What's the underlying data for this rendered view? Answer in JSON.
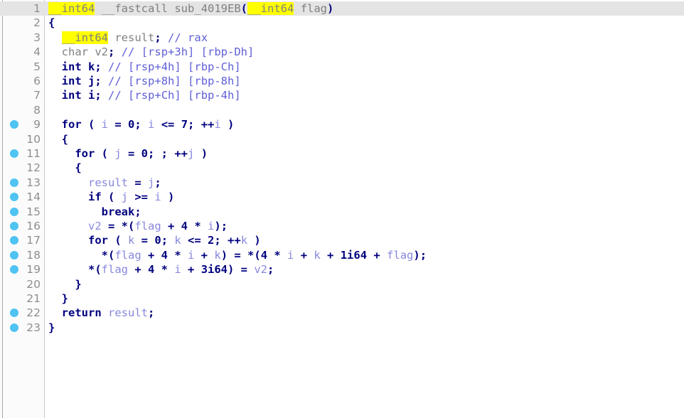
{
  "window": {
    "view": "pseudocode",
    "function_name": "sub_4019EB",
    "highlighted_token": "__int64",
    "current_line": 1
  },
  "colors": {
    "highlight_yellow": "#ffff00",
    "current_line_gray": "#e4e4e4",
    "breakpoint_blue": "#4fc3f2",
    "keyword": "#00007f",
    "comment": "#5f5fd7",
    "variable": "#8888dd",
    "type_gray": "#808080",
    "lineno_gray": "#8e8e8e",
    "background": "#ffffff",
    "gutter_background": "#fbfbfb"
  },
  "lines": [
    {
      "number": "1",
      "breakpoint": false,
      "current": true,
      "text": "__int64 __fastcall sub_4019EB(__int64 flag)",
      "tokens": [
        {
          "t": "__int64",
          "c": "t-type hl"
        },
        {
          "t": " ",
          "c": "t-type"
        },
        {
          "t": "__fastcall",
          "c": "t-type"
        },
        {
          "t": " ",
          "c": "t-type"
        },
        {
          "t": "sub_4019EB",
          "c": "t-fn"
        },
        {
          "t": "(",
          "c": "t-punc"
        },
        {
          "t": "__int64",
          "c": "t-type hl"
        },
        {
          "t": " ",
          "c": "t-type"
        },
        {
          "t": "flag",
          "c": "t-type"
        },
        {
          "t": ")",
          "c": "t-punc"
        }
      ]
    },
    {
      "number": "2",
      "breakpoint": false,
      "current": false,
      "text": "{",
      "tokens": [
        {
          "t": "{",
          "c": "t-punc"
        }
      ]
    },
    {
      "number": "3",
      "breakpoint": false,
      "current": false,
      "text": "  __int64 result; // rax",
      "tokens": [
        {
          "t": "  ",
          "c": "t-type"
        },
        {
          "t": "__int64",
          "c": "t-type hl"
        },
        {
          "t": " ",
          "c": "t-type"
        },
        {
          "t": "result",
          "c": "t-dvar"
        },
        {
          "t": ";",
          "c": "t-punc"
        },
        {
          "t": " ",
          "c": "t-type"
        },
        {
          "t": "// rax",
          "c": "t-cmt"
        }
      ]
    },
    {
      "number": "4",
      "breakpoint": false,
      "current": false,
      "text": "  char v2; // [rsp+3h] [rbp-Dh]",
      "tokens": [
        {
          "t": "  ",
          "c": "t-type"
        },
        {
          "t": "char",
          "c": "t-type"
        },
        {
          "t": " ",
          "c": "t-type"
        },
        {
          "t": "v2",
          "c": "t-dvar"
        },
        {
          "t": ";",
          "c": "t-punc"
        },
        {
          "t": " ",
          "c": "t-type"
        },
        {
          "t": "// [rsp+3h] [rbp-Dh]",
          "c": "t-cmt"
        }
      ]
    },
    {
      "number": "5",
      "breakpoint": false,
      "current": false,
      "text": "  int k; // [rsp+4h] [rbp-Ch]",
      "tokens": [
        {
          "t": "  ",
          "c": "t-type"
        },
        {
          "t": "int",
          "c": "t-kw"
        },
        {
          "t": " ",
          "c": "t-type"
        },
        {
          "t": "k",
          "c": "t-kw"
        },
        {
          "t": ";",
          "c": "t-punc"
        },
        {
          "t": " ",
          "c": "t-type"
        },
        {
          "t": "// [rsp+4h] [rbp-Ch]",
          "c": "t-cmt"
        }
      ]
    },
    {
      "number": "6",
      "breakpoint": false,
      "current": false,
      "text": "  int j; // [rsp+8h] [rbp-8h]",
      "tokens": [
        {
          "t": "  ",
          "c": "t-type"
        },
        {
          "t": "int",
          "c": "t-kw"
        },
        {
          "t": " ",
          "c": "t-type"
        },
        {
          "t": "j",
          "c": "t-kw"
        },
        {
          "t": ";",
          "c": "t-punc"
        },
        {
          "t": " ",
          "c": "t-type"
        },
        {
          "t": "// [rsp+8h] [rbp-8h]",
          "c": "t-cmt"
        }
      ]
    },
    {
      "number": "7",
      "breakpoint": false,
      "current": false,
      "text": "  int i; // [rsp+Ch] [rbp-4h]",
      "tokens": [
        {
          "t": "  ",
          "c": "t-type"
        },
        {
          "t": "int",
          "c": "t-kw"
        },
        {
          "t": " ",
          "c": "t-type"
        },
        {
          "t": "i",
          "c": "t-kw"
        },
        {
          "t": ";",
          "c": "t-punc"
        },
        {
          "t": " ",
          "c": "t-type"
        },
        {
          "t": "// [rsp+Ch] [rbp-4h]",
          "c": "t-cmt"
        }
      ]
    },
    {
      "number": "8",
      "breakpoint": false,
      "current": false,
      "text": "",
      "tokens": []
    },
    {
      "number": "9",
      "breakpoint": true,
      "current": false,
      "text": "  for ( i = 0; i <= 7; ++i )",
      "tokens": [
        {
          "t": "  ",
          "c": "t-type"
        },
        {
          "t": "for",
          "c": "t-kw"
        },
        {
          "t": " ( ",
          "c": "t-punc"
        },
        {
          "t": "i",
          "c": "t-var"
        },
        {
          "t": " = ",
          "c": "t-punc"
        },
        {
          "t": "0",
          "c": "t-num"
        },
        {
          "t": "; ",
          "c": "t-punc"
        },
        {
          "t": "i",
          "c": "t-var"
        },
        {
          "t": " <= ",
          "c": "t-punc"
        },
        {
          "t": "7",
          "c": "t-num"
        },
        {
          "t": "; ++",
          "c": "t-punc"
        },
        {
          "t": "i",
          "c": "t-var"
        },
        {
          "t": " )",
          "c": "t-punc"
        }
      ]
    },
    {
      "number": "10",
      "breakpoint": false,
      "current": false,
      "text": "  {",
      "tokens": [
        {
          "t": "  ",
          "c": "t-type"
        },
        {
          "t": "{",
          "c": "t-punc"
        }
      ]
    },
    {
      "number": "11",
      "breakpoint": true,
      "current": false,
      "text": "    for ( j = 0; ; ++j )",
      "tokens": [
        {
          "t": "    ",
          "c": "t-type"
        },
        {
          "t": "for",
          "c": "t-kw"
        },
        {
          "t": " ( ",
          "c": "t-punc"
        },
        {
          "t": "j",
          "c": "t-var"
        },
        {
          "t": " = ",
          "c": "t-punc"
        },
        {
          "t": "0",
          "c": "t-num"
        },
        {
          "t": "; ; ++",
          "c": "t-punc"
        },
        {
          "t": "j",
          "c": "t-var"
        },
        {
          "t": " )",
          "c": "t-punc"
        }
      ]
    },
    {
      "number": "12",
      "breakpoint": false,
      "current": false,
      "text": "    {",
      "tokens": [
        {
          "t": "    ",
          "c": "t-type"
        },
        {
          "t": "{",
          "c": "t-punc"
        }
      ]
    },
    {
      "number": "13",
      "breakpoint": true,
      "current": false,
      "text": "      result = j;",
      "tokens": [
        {
          "t": "      ",
          "c": "t-type"
        },
        {
          "t": "result",
          "c": "t-var"
        },
        {
          "t": " = ",
          "c": "t-punc"
        },
        {
          "t": "j",
          "c": "t-var"
        },
        {
          "t": ";",
          "c": "t-punc"
        }
      ]
    },
    {
      "number": "14",
      "breakpoint": true,
      "current": false,
      "text": "      if ( j >= i )",
      "tokens": [
        {
          "t": "      ",
          "c": "t-type"
        },
        {
          "t": "if",
          "c": "t-kw"
        },
        {
          "t": " ( ",
          "c": "t-punc"
        },
        {
          "t": "j",
          "c": "t-var"
        },
        {
          "t": " >= ",
          "c": "t-punc"
        },
        {
          "t": "i",
          "c": "t-var"
        },
        {
          "t": " )",
          "c": "t-punc"
        }
      ]
    },
    {
      "number": "15",
      "breakpoint": true,
      "current": false,
      "text": "        break;",
      "tokens": [
        {
          "t": "        ",
          "c": "t-type"
        },
        {
          "t": "break",
          "c": "t-kw"
        },
        {
          "t": ";",
          "c": "t-punc"
        }
      ]
    },
    {
      "number": "16",
      "breakpoint": true,
      "current": false,
      "text": "      v2 = *(flag + 4 * i);",
      "tokens": [
        {
          "t": "      ",
          "c": "t-type"
        },
        {
          "t": "v2",
          "c": "t-var"
        },
        {
          "t": " = *(",
          "c": "t-punc"
        },
        {
          "t": "flag",
          "c": "t-var"
        },
        {
          "t": " + ",
          "c": "t-punc"
        },
        {
          "t": "4",
          "c": "t-num"
        },
        {
          "t": " * ",
          "c": "t-punc"
        },
        {
          "t": "i",
          "c": "t-var"
        },
        {
          "t": ");",
          "c": "t-punc"
        }
      ]
    },
    {
      "number": "17",
      "breakpoint": true,
      "current": false,
      "text": "      for ( k = 0; k <= 2; ++k )",
      "tokens": [
        {
          "t": "      ",
          "c": "t-type"
        },
        {
          "t": "for",
          "c": "t-kw"
        },
        {
          "t": " ( ",
          "c": "t-punc"
        },
        {
          "t": "k",
          "c": "t-var"
        },
        {
          "t": " = ",
          "c": "t-punc"
        },
        {
          "t": "0",
          "c": "t-num"
        },
        {
          "t": "; ",
          "c": "t-punc"
        },
        {
          "t": "k",
          "c": "t-var"
        },
        {
          "t": " <= ",
          "c": "t-punc"
        },
        {
          "t": "2",
          "c": "t-num"
        },
        {
          "t": "; ++",
          "c": "t-punc"
        },
        {
          "t": "k",
          "c": "t-var"
        },
        {
          "t": " )",
          "c": "t-punc"
        }
      ]
    },
    {
      "number": "18",
      "breakpoint": true,
      "current": false,
      "text": "        *(flag + 4 * i + k) = *(4 * i + k + 1i64 + flag);",
      "tokens": [
        {
          "t": "        ",
          "c": "t-type"
        },
        {
          "t": "*(",
          "c": "t-punc"
        },
        {
          "t": "flag",
          "c": "t-var"
        },
        {
          "t": " + ",
          "c": "t-punc"
        },
        {
          "t": "4",
          "c": "t-num"
        },
        {
          "t": " * ",
          "c": "t-punc"
        },
        {
          "t": "i",
          "c": "t-var"
        },
        {
          "t": " + ",
          "c": "t-punc"
        },
        {
          "t": "k",
          "c": "t-var"
        },
        {
          "t": ") = *(",
          "c": "t-punc"
        },
        {
          "t": "4",
          "c": "t-num"
        },
        {
          "t": " * ",
          "c": "t-punc"
        },
        {
          "t": "i",
          "c": "t-var"
        },
        {
          "t": " + ",
          "c": "t-punc"
        },
        {
          "t": "k",
          "c": "t-var"
        },
        {
          "t": " + ",
          "c": "t-punc"
        },
        {
          "t": "1i64",
          "c": "t-num"
        },
        {
          "t": " + ",
          "c": "t-punc"
        },
        {
          "t": "flag",
          "c": "t-var"
        },
        {
          "t": ");",
          "c": "t-punc"
        }
      ]
    },
    {
      "number": "19",
      "breakpoint": true,
      "current": false,
      "text": "      *(flag + 4 * i + 3i64) = v2;",
      "tokens": [
        {
          "t": "      ",
          "c": "t-type"
        },
        {
          "t": "*(",
          "c": "t-punc"
        },
        {
          "t": "flag",
          "c": "t-var"
        },
        {
          "t": " + ",
          "c": "t-punc"
        },
        {
          "t": "4",
          "c": "t-num"
        },
        {
          "t": " * ",
          "c": "t-punc"
        },
        {
          "t": "i",
          "c": "t-var"
        },
        {
          "t": " + ",
          "c": "t-punc"
        },
        {
          "t": "3i64",
          "c": "t-num"
        },
        {
          "t": ") = ",
          "c": "t-punc"
        },
        {
          "t": "v2",
          "c": "t-var"
        },
        {
          "t": ";",
          "c": "t-punc"
        }
      ]
    },
    {
      "number": "20",
      "breakpoint": false,
      "current": false,
      "text": "    }",
      "tokens": [
        {
          "t": "    ",
          "c": "t-type"
        },
        {
          "t": "}",
          "c": "t-punc"
        }
      ]
    },
    {
      "number": "21",
      "breakpoint": false,
      "current": false,
      "text": "  }",
      "tokens": [
        {
          "t": "  ",
          "c": "t-type"
        },
        {
          "t": "}",
          "c": "t-punc"
        }
      ]
    },
    {
      "number": "22",
      "breakpoint": true,
      "current": false,
      "text": "  return result;",
      "tokens": [
        {
          "t": "  ",
          "c": "t-type"
        },
        {
          "t": "return",
          "c": "t-kw"
        },
        {
          "t": " ",
          "c": "t-type"
        },
        {
          "t": "result",
          "c": "t-var"
        },
        {
          "t": ";",
          "c": "t-punc"
        }
      ]
    },
    {
      "number": "23",
      "breakpoint": true,
      "current": false,
      "text": "}",
      "tokens": [
        {
          "t": "}",
          "c": "t-punc"
        }
      ]
    }
  ]
}
